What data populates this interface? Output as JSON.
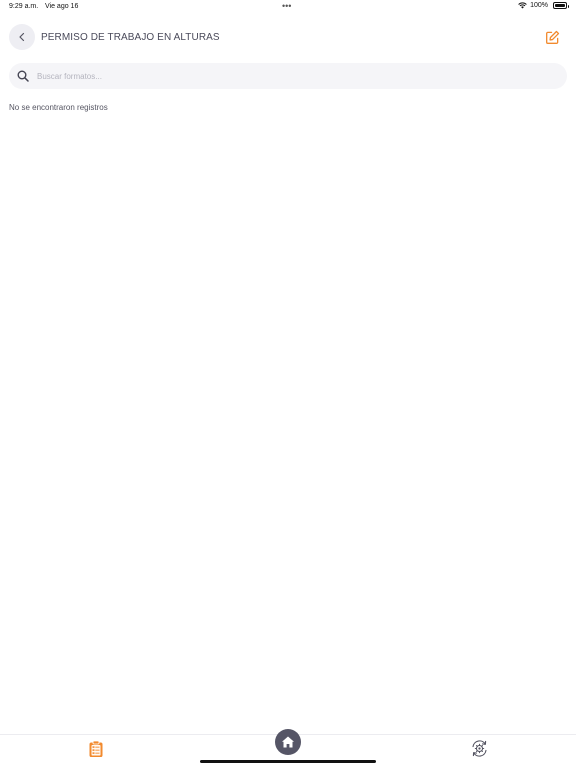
{
  "status_bar": {
    "time": "9:29 a.m.",
    "date": "Vie ago 16",
    "battery": "100%"
  },
  "header": {
    "title": "PERMISO DE TRABAJO EN ALTURAS"
  },
  "search": {
    "placeholder": "Buscar formatos..."
  },
  "list": {
    "empty_message": "No se encontraron registros"
  },
  "tab_bar": {
    "items": [
      {
        "icon": "clipboard-list-icon"
      },
      {
        "icon": "home-icon"
      },
      {
        "icon": "sync-settings-icon"
      }
    ]
  },
  "colors": {
    "accent": "#f28a2e",
    "home_button": "#555566",
    "back_button_bg": "#eeeef3",
    "search_bg": "#f5f5f8"
  }
}
